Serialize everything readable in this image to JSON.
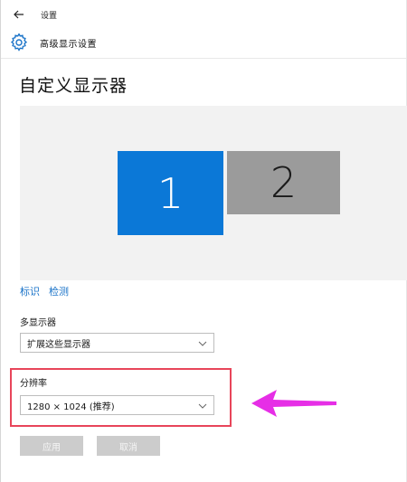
{
  "nav": {
    "title": "设置"
  },
  "header": {
    "title": "高级显示设置"
  },
  "main": {
    "page_title": "自定义显示器",
    "monitors": [
      {
        "label": "1",
        "selected": true
      },
      {
        "label": "2",
        "selected": false
      }
    ],
    "links": {
      "identify": "标识",
      "detect": "检测"
    },
    "multiple_displays": {
      "label": "多显示器",
      "value": "扩展这些显示器"
    },
    "resolution": {
      "label": "分辨率",
      "value": "1280 × 1024 (推荐)"
    },
    "buttons": {
      "apply": "应用",
      "cancel": "取消"
    }
  },
  "icons": {
    "back": "back-arrow-icon",
    "settings": "gear-icon",
    "dropdown": "chevron-down-icon",
    "annotation": "pointer-arrow-icon"
  },
  "colors": {
    "accent": "#0b78d7",
    "monitor_inactive": "#9b9b9b",
    "link": "#1a73c8",
    "highlight": "#e8455a",
    "annotation_arrow": "#e62ee6",
    "button_disabled": "#cccccc"
  }
}
